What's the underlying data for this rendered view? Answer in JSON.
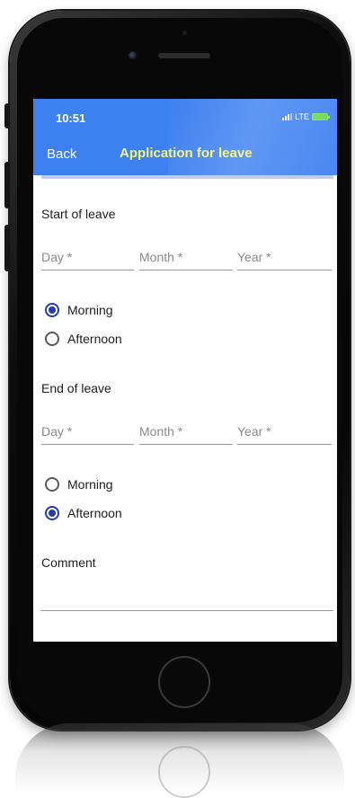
{
  "status_bar": {
    "time": "10:51",
    "network": "LTE"
  },
  "nav": {
    "back_label": "Back",
    "title": "Application for leave"
  },
  "form": {
    "start_label": "Start of leave",
    "start_fields": {
      "day": "Day *",
      "month": "Month *",
      "year": "Year *"
    },
    "start_options": [
      {
        "label": "Morning",
        "selected": true
      },
      {
        "label": "Afternoon",
        "selected": false
      }
    ],
    "end_label": "End of leave",
    "end_fields": {
      "day": "Day *",
      "month": "Month *",
      "year": "Year *"
    },
    "end_options": [
      {
        "label": "Morning",
        "selected": false
      },
      {
        "label": "Afternoon",
        "selected": true
      }
    ],
    "comment_label": "Comment"
  },
  "colors": {
    "header": "#3d80f0",
    "title": "#f4f57e",
    "radio_selected": "#233db0",
    "strip": "#c7c9ea"
  },
  "icons": [
    "camera-icon",
    "speaker-icon",
    "signal-icon",
    "battery-icon",
    "home-button"
  ]
}
